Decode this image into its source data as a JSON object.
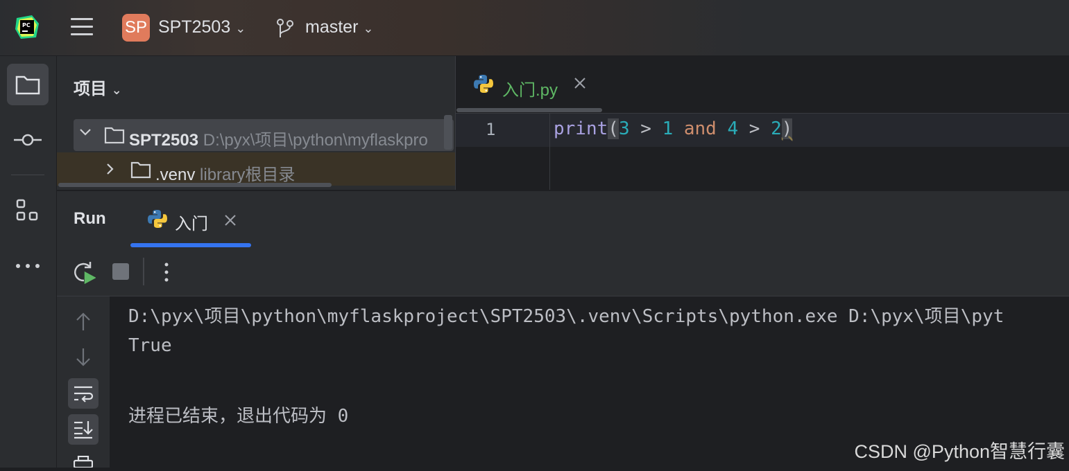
{
  "titlebar": {
    "app_icon": "pycharm-logo-icon",
    "menu_icon": "hamburger-menu-icon",
    "project_badge": "SP",
    "project_name": "SPT2503",
    "branch_icon": "git-branch-icon",
    "branch_name": "master"
  },
  "left_strip": {
    "items": [
      {
        "icon": "folder-icon",
        "active": true
      },
      {
        "icon": "commit-icon",
        "active": false
      },
      {
        "icon": "structure-icon",
        "active": false
      },
      {
        "icon": "more-icon",
        "active": false
      }
    ]
  },
  "project_panel": {
    "title": "项目",
    "tree": [
      {
        "name": "SPT2503",
        "path": "D:\\pyx\\项目\\python\\myflaskpro",
        "expanded": true
      },
      {
        "name": ".venv",
        "note": "library根目录",
        "expanded": false
      }
    ]
  },
  "editor": {
    "tab_label": "入门.py",
    "line_number": "1",
    "code": {
      "fn": "print",
      "open": "(",
      "a": "3",
      "op1": " > ",
      "b": "1",
      "kw": " and ",
      "c": "4",
      "op2": " > ",
      "d": "2",
      "close": ")"
    }
  },
  "run_panel": {
    "title": "Run",
    "tab_label": "入门",
    "console_lines": [
      "D:\\pyx\\项目\\python\\myflaskproject\\SPT2503\\.venv\\Scripts\\python.exe D:\\pyx\\项目\\pyt",
      "True",
      "",
      "进程已结束，退出代码为 0"
    ]
  },
  "watermark": "CSDN @Python智慧行囊",
  "colors": {
    "accent_blue": "#3574f0",
    "keyword_orange": "#cf8e6d",
    "number_cyan": "#2aacb8",
    "function_purple": "#a9a1e1"
  }
}
